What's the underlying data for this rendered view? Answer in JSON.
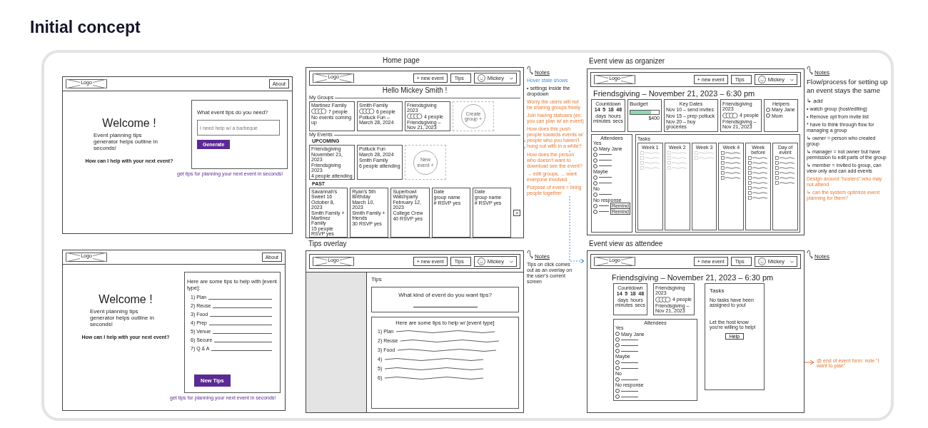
{
  "heading": "Initial concept",
  "welcome": {
    "logo": "Logo",
    "about": "About",
    "title": "Welcome !",
    "subtitle": "Event planning tips generator helps outline in seconds!",
    "question": "How can I help with your next event?",
    "card_title": "What event tips do you need?",
    "placeholder": "I need help w/ a barbeque",
    "button": "Generate",
    "hint": "get tips for planning your next event in seconds!"
  },
  "home": {
    "caption": "Home page",
    "header": {
      "logo": "Logo",
      "nav": [
        "+ new event",
        "Tips"
      ],
      "user": "Mickey"
    },
    "greeting": "Hello Mickey Smith !",
    "groups_label": "My Groups",
    "groups": [
      {
        "name": "Martinez Family",
        "count": "7 people",
        "footer": "No events coming up"
      },
      {
        "name": "Smith Family",
        "count": "6 people",
        "footer": "Potluck Fun – March 28, 2024"
      },
      {
        "name": "Friendsgiving 2023",
        "count": "4 people",
        "footer": "Friendsgiving – Nov 21, 2023"
      }
    ],
    "new_group": "Create group +",
    "events_label": "My Events",
    "upcoming_label": "UPCOMING",
    "upcoming": [
      {
        "name": "Friendsgiving",
        "date": "November 21, 2023",
        "group": "Friendsgiving 2023",
        "footer": "4 people attending"
      },
      {
        "name": "Potluck Fun",
        "date": "March 28, 2024",
        "group": "Smith Family",
        "footer": "6 people attending"
      }
    ],
    "new_event": "New event +",
    "past_label": "PAST",
    "past": [
      {
        "name": "Savannah's Sweet 16",
        "date": "October 8, 2023",
        "group": "Smith Family + Martinez Family",
        "footer": "15 people RSVP yes"
      },
      {
        "name": "Ryan's 5th Birthday",
        "date": "March 10, 2023",
        "group": "Smith Family + friends",
        "footer": "30 RSVP yes"
      },
      {
        "name": "Superbowl Watchparty",
        "date": "February 12, 2023",
        "group": "College Crew",
        "footer": "40 RSVP yes"
      },
      {
        "name": "Date",
        "group": "group name",
        "footer": "# RSVP yes"
      },
      {
        "name": "Date",
        "group": "group name",
        "footer": "# RSVP yes"
      }
    ],
    "next": ">"
  },
  "home_notes": {
    "title": "Notes",
    "items": [
      {
        "kind": "interaction",
        "text": "Hover state shows"
      },
      {
        "kind": "remark",
        "text": "• settings inside the dropdown"
      },
      {
        "kind": "question",
        "text": "Worry the users will not be sharing groups freely"
      },
      {
        "kind": "question",
        "text": "Join having statuses (ex: you can plan w/ an event)"
      },
      {
        "kind": "question",
        "text": "How does this push people towards events w/ people who you haven't hung out with in a while?"
      },
      {
        "kind": "question",
        "text": "How does the person who doesn't want to download see the event?"
      },
      {
        "kind": "question",
        "text": "→ edit groups, ... want everyone involved"
      },
      {
        "kind": "question",
        "text": "Purpose of event = bring people together"
      }
    ]
  },
  "organizer": {
    "caption": "Event view as organizer",
    "header": {
      "logo": "Logo",
      "nav": [
        "+ new event",
        "Tips"
      ],
      "user": "Mickey"
    },
    "title": "Friendsgiving – November 21, 2023 – 6:30 pm",
    "countdown": {
      "label": "Countdown",
      "values": [
        {
          "value": "14",
          "unit": "days"
        },
        {
          "value": "5",
          "unit": "hours"
        },
        {
          "value": "18",
          "unit": "minutes"
        },
        {
          "value": "48",
          "unit": "secs"
        }
      ]
    },
    "budget": {
      "label": "Budget",
      "level": 0.72,
      "amount": "$400"
    },
    "key_dates": {
      "label": "Key Dates",
      "items": [
        "Nov 10 – send invites",
        "Nov 15 – prep potluck",
        "Nov 20 – buy groceries"
      ]
    },
    "group": {
      "name": "Friendsgiving 2023",
      "count": "4 people",
      "footer": "Friendsgiving – Nov 21, 2023"
    },
    "helpers": {
      "label": "Helpers",
      "items": [
        "Mary Jane",
        "Mom"
      ]
    },
    "attendees": {
      "label": "Attendees",
      "sections": [
        {
          "label": "Yes",
          "people": [
            {
              "kind": "named",
              "name": "Mary Jane"
            },
            {
              "kind": "blank"
            },
            {
              "kind": "blank"
            },
            {
              "kind": "blank"
            }
          ]
        },
        {
          "label": "Maybe",
          "people": [
            {
              "kind": "blank"
            },
            {
              "kind": "blank"
            }
          ]
        },
        {
          "label": "No",
          "people": [
            {
              "kind": "blank"
            }
          ]
        },
        {
          "label": "No response",
          "people": [
            {
              "kind": "blank",
              "action": "Remind"
            },
            {
              "kind": "blank",
              "action": "Remind"
            }
          ]
        }
      ]
    },
    "tasks": {
      "label": "Tasks",
      "columns": [
        {
          "label": "Week 1",
          "tasks": [
            {
              "done": true
            },
            {
              "done": true
            },
            {
              "done": true
            },
            {
              "done": true
            }
          ]
        },
        {
          "label": "Week 2",
          "tasks": [
            {
              "done": true
            },
            {
              "done": true
            },
            {
              "done": true
            },
            {
              "done": true
            }
          ]
        },
        {
          "label": "Week 3",
          "tasks": [
            {
              "done": true
            },
            {
              "done": true
            }
          ]
        },
        {
          "label": "Week 4",
          "tasks": [
            {
              "done": false
            },
            {
              "done": false
            },
            {
              "done": false
            },
            {
              "done": false
            },
            {
              "done": false
            },
            {
              "done": false
            }
          ]
        },
        {
          "label": "Week before",
          "tasks": [
            {
              "done": false
            },
            {
              "done": false
            },
            {
              "done": false
            },
            {
              "done": false
            },
            {
              "done": false
            },
            {
              "done": false
            },
            {
              "done": false
            },
            {
              "done": false
            },
            {
              "done": false
            }
          ]
        },
        {
          "label": "Day of event",
          "tasks": [
            {
              "done": false
            },
            {
              "done": false
            },
            {
              "done": false
            },
            {
              "done": false
            },
            {
              "done": false
            },
            {
              "done": false
            }
          ]
        }
      ]
    }
  },
  "organizer_notes": {
    "title": "Notes",
    "items": [
      {
        "kind": "heading",
        "text": "Flow/process for setting up an event stays the same"
      },
      {
        "kind": "subheading",
        "text": "↳ add"
      },
      {
        "kind": "remark",
        "text": "• watch group (host/editing)"
      },
      {
        "kind": "remark",
        "text": "• Remove opt from invite list"
      },
      {
        "kind": "remark",
        "text": "* have to think through flow for managing a group"
      },
      {
        "kind": "remark",
        "text": "↳ owner = person who created group"
      },
      {
        "kind": "remark",
        "text": "↳ manager = not owner but have permission to edit parts of the group"
      },
      {
        "kind": "remark",
        "text": "↳ member = invited to group, can view only and can add events"
      },
      {
        "kind": "question",
        "text": "Design around \"hosters\" who may not attend"
      },
      {
        "kind": "question",
        "text": "↳ can the system optimize event planning for them?"
      }
    ]
  },
  "tips_page": {
    "logo": "Logo",
    "about": "About",
    "title": "Welcome !",
    "subtitle": "Event planning tips generator helps outline in seconds!",
    "question": "How can I help with your next event?",
    "card_title": "Here are some tips to help with [event type]:",
    "tips": [
      "1) Plan",
      "2) Reuse",
      "3) Food",
      "4) Prep",
      "5) Venue",
      "6) Secure",
      "7) Q & A"
    ],
    "button": "New Tips",
    "hint": "get tips for planning your next event in seconds!"
  },
  "tips_overlay": {
    "caption": "Tips overlay",
    "header": {
      "logo": "Logo",
      "nav": [
        "+ new event",
        "Tips"
      ],
      "user": "Mickey"
    },
    "title": "Tips",
    "question": "What kind of event do you want tips?",
    "answer_title": "Here are some tips to help w/ [event type]",
    "tips": [
      "1) Plan",
      "2) Reuse",
      "3) Food",
      "4)",
      "5)",
      "6)"
    ]
  },
  "tips_notes": {
    "title": "Notes",
    "items": [
      {
        "kind": "remark",
        "text": "Tips on click comes out as an overlay on the user's current screen"
      }
    ]
  },
  "attendee": {
    "caption": "Event view as attendee",
    "header": {
      "logo": "Logo",
      "nav": [
        "+ new event",
        "Tips"
      ],
      "user": "Mickey"
    },
    "title": "Friendsgiving – November 21, 2023 – 6:30 pm",
    "countdown": {
      "label": "Countdown",
      "values": [
        {
          "value": "14",
          "unit": "days"
        },
        {
          "value": "5",
          "unit": "hours"
        },
        {
          "value": "18",
          "unit": "minutes"
        },
        {
          "value": "48",
          "unit": "secs"
        }
      ]
    },
    "group": {
      "name": "Friendsgiving 2023",
      "count": "4 people",
      "footer": "Friendsgiving – Nov 21, 2023"
    },
    "attendees": {
      "label": "Attendees",
      "sections": [
        {
          "label": "Yes",
          "people": [
            {
              "kind": "named",
              "name": "Mary Jane"
            },
            {
              "kind": "blank"
            },
            {
              "kind": "blank"
            },
            {
              "kind": "blank"
            }
          ]
        },
        {
          "label": "Maybe",
          "people": [
            {
              "kind": "blank"
            },
            {
              "kind": "blank"
            }
          ]
        },
        {
          "label": "No",
          "people": [
            {
              "kind": "blank"
            }
          ]
        },
        {
          "label": "No response",
          "people": [
            {
              "kind": "blank"
            },
            {
              "kind": "blank"
            }
          ]
        }
      ]
    },
    "tasks": {
      "label": "Tasks",
      "empty": "No tasks have been assigned to you!",
      "prompt": "Let the host know you're willing to help!",
      "button": "Help"
    },
    "side_note": "@ end of event form: note \"I want to plan\""
  },
  "attendee_notes": {
    "title": "Notes"
  }
}
